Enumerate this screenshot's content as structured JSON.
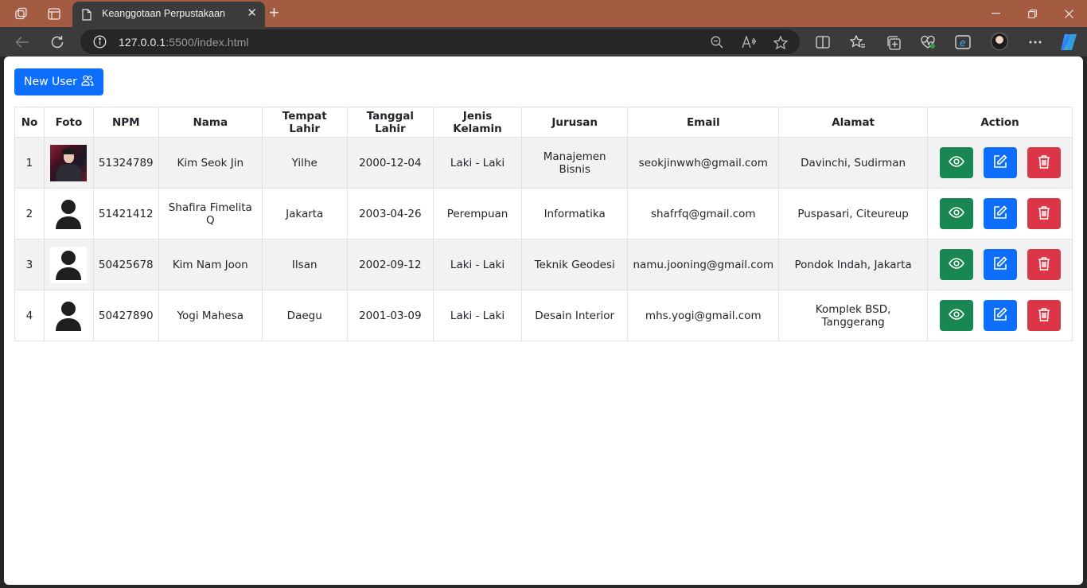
{
  "browser": {
    "tab_title": "Keanggotaan Perpustakaan",
    "url_host": "127.0.0.1",
    "url_rest": ":5500/index.html"
  },
  "page": {
    "new_user_label": "New User",
    "columns": [
      "No",
      "Foto",
      "NPM",
      "Nama",
      "Tempat Lahir",
      "Tanggal Lahir",
      "Jenis Kelamin",
      "Jurusan",
      "Email",
      "Alamat",
      "Action"
    ],
    "rows": [
      {
        "no": "1",
        "photo": "person-photo",
        "npm": "51324789",
        "nama": "Kim Seok Jin",
        "tempat_lahir": "Yilhe",
        "tanggal_lahir": "2000-12-04",
        "jenis_kelamin": "Laki - Laki",
        "jurusan": "Manajemen Bisnis",
        "email": "seokjinwwh@gmail.com",
        "alamat": "Davinchi, Sudirman"
      },
      {
        "no": "2",
        "photo": "user-placeholder-icon",
        "npm": "51421412",
        "nama": "Shafira Fimelita Q",
        "tempat_lahir": "Jakarta",
        "tanggal_lahir": "2003-04-26",
        "jenis_kelamin": "Perempuan",
        "jurusan": "Informatika",
        "email": "shafrfq@gmail.com",
        "alamat": "Puspasari, Citeureup"
      },
      {
        "no": "3",
        "photo": "user-placeholder-icon",
        "npm": "50425678",
        "nama": "Kim Nam Joon",
        "tempat_lahir": "Ilsan",
        "tanggal_lahir": "2002-09-12",
        "jenis_kelamin": "Laki - Laki",
        "jurusan": "Teknik Geodesi",
        "email": "namu.jooning@gmail.com",
        "alamat": "Pondok Indah, Jakarta"
      },
      {
        "no": "4",
        "photo": "user-placeholder-icon",
        "npm": "50427890",
        "nama": "Yogi Mahesa",
        "tempat_lahir": "Daegu",
        "tanggal_lahir": "2001-03-09",
        "jenis_kelamin": "Laki - Laki",
        "jurusan": "Desain Interior",
        "email": "mhs.yogi@gmail.com",
        "alamat": "Komplek BSD, Tanggerang"
      }
    ],
    "action_icons": [
      "eye-icon",
      "edit-icon",
      "trash-icon"
    ]
  },
  "colors": {
    "titlebar": "#a35b42",
    "primary": "#0d6efd",
    "success": "#198754",
    "danger": "#dc3545"
  }
}
